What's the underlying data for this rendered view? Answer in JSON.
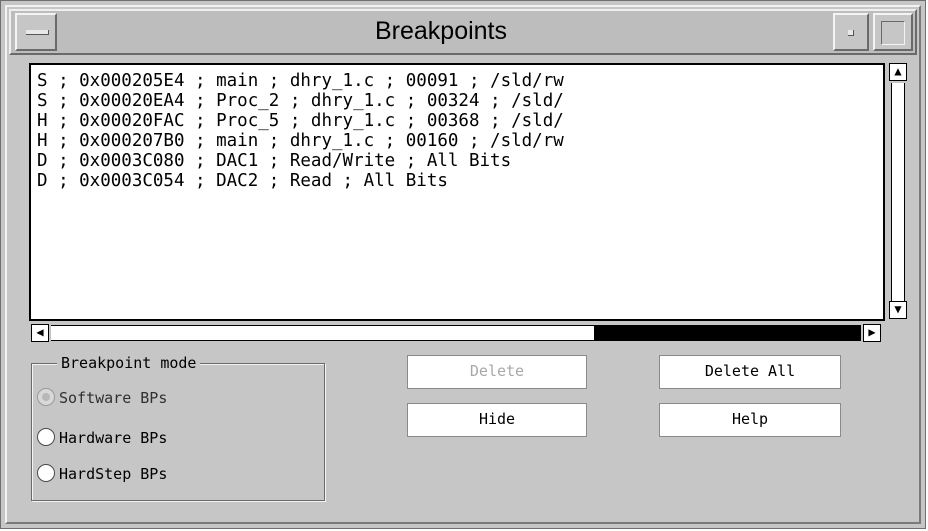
{
  "window": {
    "title": "Breakpoints"
  },
  "breakpoints": {
    "items": [
      "S ; 0x000205E4 ; main ; dhry_1.c ; 00091 ; /sld/rw",
      "S ; 0x00020EA4 ; Proc_2 ; dhry_1.c ; 00324 ; /sld/",
      "H ; 0x00020FAC ; Proc_5 ; dhry_1.c ; 00368 ; /sld/",
      "H ; 0x000207B0 ; main ; dhry_1.c ; 00160 ; /sld/rw",
      "D ; 0x0003C080 ; DAC1 ; Read/Write ; All Bits",
      "D ; 0x0003C054 ; DAC2 ; Read ; All Bits"
    ]
  },
  "mode": {
    "legend": "Breakpoint mode",
    "options": [
      {
        "label": "Software BPs",
        "selected": true
      },
      {
        "label": "Hardware BPs",
        "selected": false
      },
      {
        "label": "HardStep BPs",
        "selected": false
      }
    ]
  },
  "buttons": {
    "delete": "Delete",
    "delete_all": "Delete All",
    "hide": "Hide",
    "help": "Help"
  },
  "scroll": {
    "horizontal_thumb_fraction": 0.33,
    "horizontal_position_fraction": 1.0
  }
}
